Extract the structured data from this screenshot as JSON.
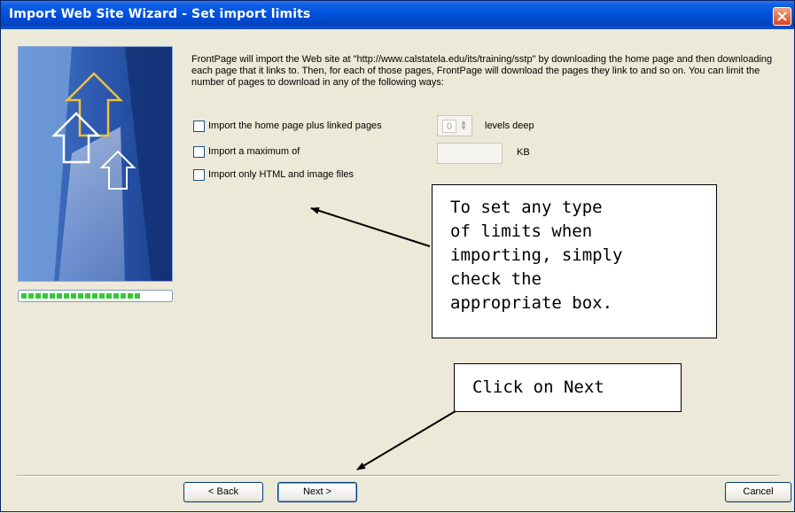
{
  "window": {
    "title": "Import Web Site Wizard - Set import limits"
  },
  "intro_text": "FrontPage will import the Web site at \"http://www.calstatela.edu/its/training/sstp\" by downloading the home page and then downloading each page that it links to.  Then, for each of those pages, FrontPage will download the pages they link to and so on.  You can limit the number of pages to download in any of the following ways:",
  "options": [
    {
      "label": "Import the home page plus linked pages",
      "checked": false
    },
    {
      "label": "Import a maximum of",
      "checked": false
    },
    {
      "label": "Import only HTML and image files",
      "checked": false
    }
  ],
  "levels": {
    "value": "0",
    "suffix": "levels deep"
  },
  "max_size": {
    "value": "",
    "unit": "KB"
  },
  "progress": {
    "fraction": 0.85
  },
  "callouts": {
    "limits": "To set any type\nof limits when\nimporting, simply\ncheck the\nappropriate box.",
    "next": "Click on Next"
  },
  "buttons": {
    "back": "< Back",
    "next": "Next >",
    "cancel": "Cancel"
  },
  "colors": {
    "title_bar": "#0051da",
    "close": "#d9431d",
    "dialog_bg": "#ece9d8",
    "progress": "#37c837"
  }
}
